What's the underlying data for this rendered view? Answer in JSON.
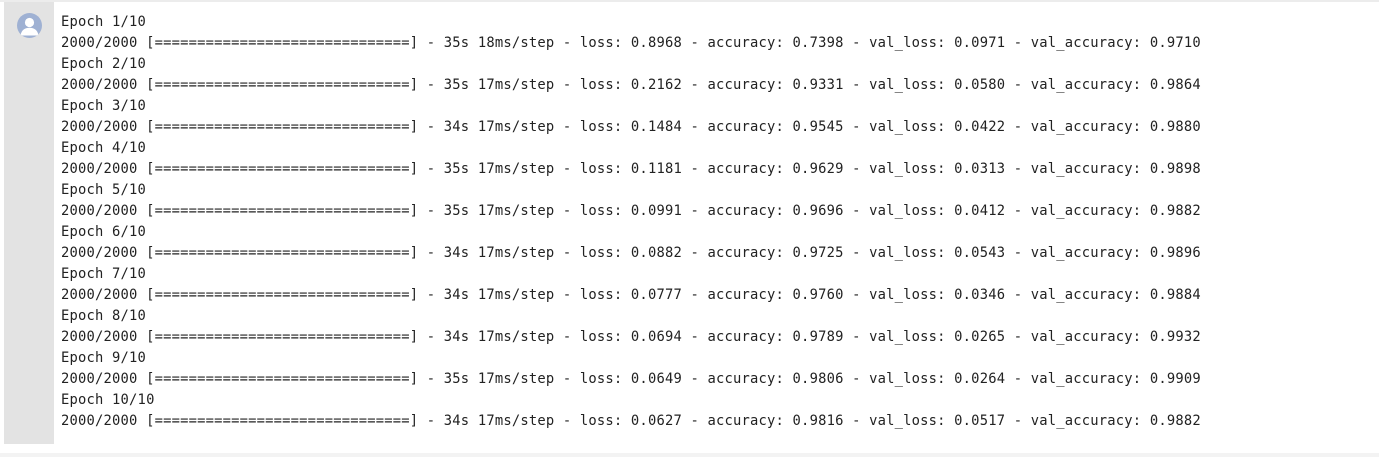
{
  "output": {
    "avatar_icon": "user-avatar-icon",
    "lines": [
      "Epoch 1/10",
      "2000/2000 [==============================] - 35s 18ms/step - loss: 0.8968 - accuracy: 0.7398 - val_loss: 0.0971 - val_accuracy: 0.9710",
      "Epoch 2/10",
      "2000/2000 [==============================] - 35s 17ms/step - loss: 0.2162 - accuracy: 0.9331 - val_loss: 0.0580 - val_accuracy: 0.9864",
      "Epoch 3/10",
      "2000/2000 [==============================] - 34s 17ms/step - loss: 0.1484 - accuracy: 0.9545 - val_loss: 0.0422 - val_accuracy: 0.9880",
      "Epoch 4/10",
      "2000/2000 [==============================] - 35s 17ms/step - loss: 0.1181 - accuracy: 0.9629 - val_loss: 0.0313 - val_accuracy: 0.9898",
      "Epoch 5/10",
      "2000/2000 [==============================] - 35s 17ms/step - loss: 0.0991 - accuracy: 0.9696 - val_loss: 0.0412 - val_accuracy: 0.9882",
      "Epoch 6/10",
      "2000/2000 [==============================] - 34s 17ms/step - loss: 0.0882 - accuracy: 0.9725 - val_loss: 0.0543 - val_accuracy: 0.9896",
      "Epoch 7/10",
      "2000/2000 [==============================] - 34s 17ms/step - loss: 0.0777 - accuracy: 0.9760 - val_loss: 0.0346 - val_accuracy: 0.9884",
      "Epoch 8/10",
      "2000/2000 [==============================] - 34s 17ms/step - loss: 0.0694 - accuracy: 0.9789 - val_loss: 0.0265 - val_accuracy: 0.9932",
      "Epoch 9/10",
      "2000/2000 [==============================] - 35s 17ms/step - loss: 0.0649 - accuracy: 0.9806 - val_loss: 0.0264 - val_accuracy: 0.9909",
      "Epoch 10/10",
      "2000/2000 [==============================] - 34s 17ms/step - loss: 0.0627 - accuracy: 0.9816 - val_loss: 0.0517 - val_accuracy: 0.9882"
    ]
  },
  "colors": {
    "gutter": "#e3e3e3",
    "avatar": "#9fb1d3",
    "text": "#222222"
  }
}
